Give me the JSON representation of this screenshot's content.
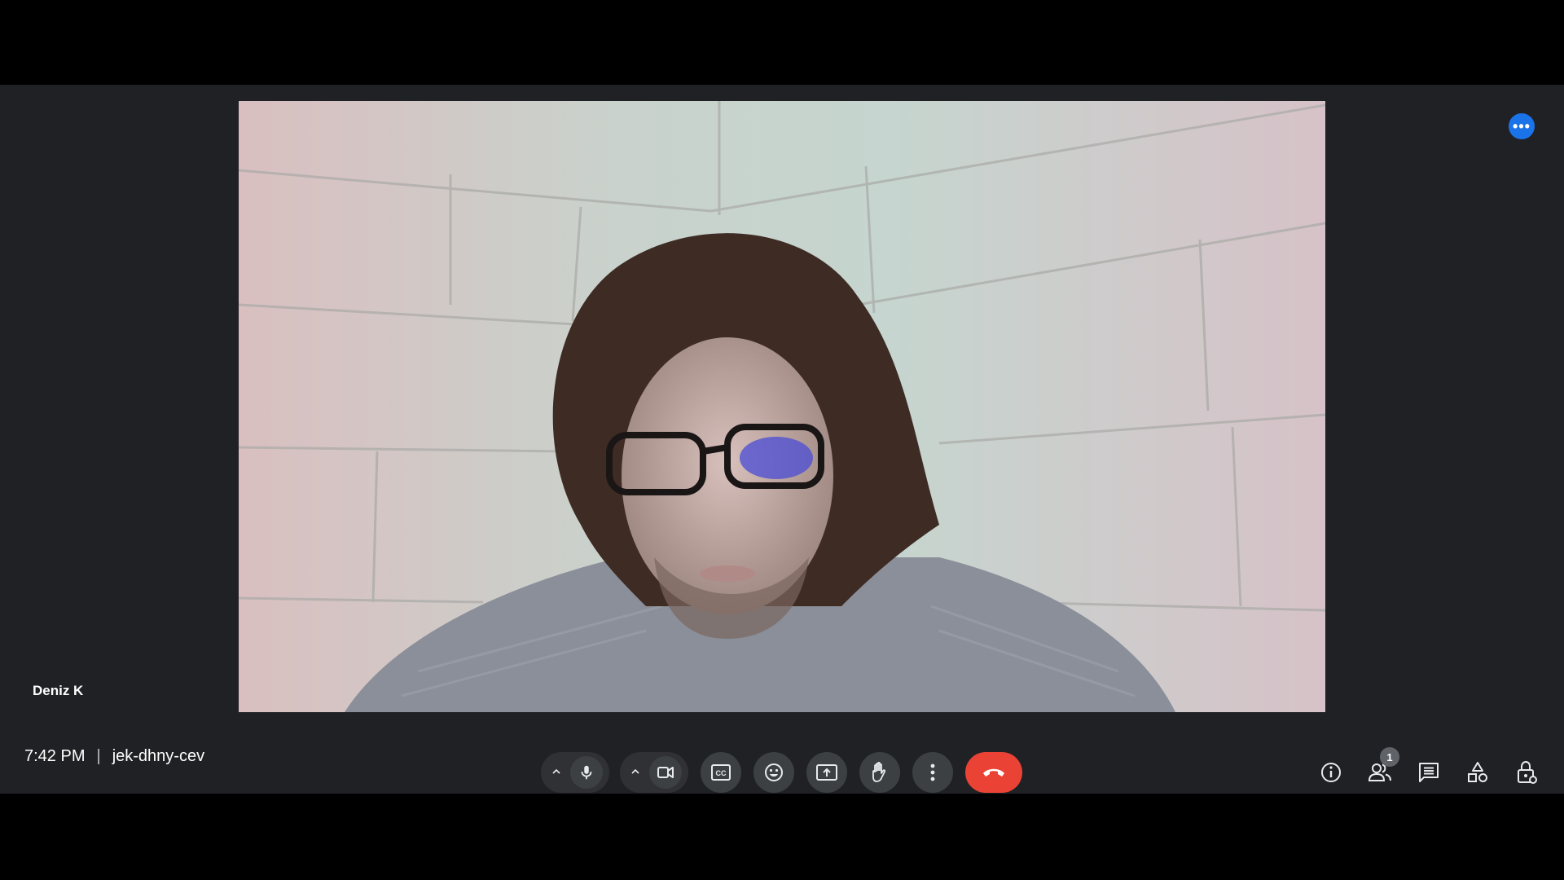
{
  "participant": {
    "name": "Deniz K"
  },
  "meeting": {
    "time": "7:42 PM",
    "separator": "|",
    "code": "jek-dhny-cev"
  },
  "tile_menu": {
    "label": "•••",
    "color": "#1a73e8"
  },
  "controls": [
    {
      "name": "audio-options-caret-icon"
    },
    {
      "name": "microphone-icon"
    },
    {
      "name": "video-options-caret-icon"
    },
    {
      "name": "camera-icon"
    },
    {
      "name": "captions-icon"
    },
    {
      "name": "emoji-icon"
    },
    {
      "name": "present-screen-icon"
    },
    {
      "name": "raise-hand-icon"
    },
    {
      "name": "more-options-icon"
    },
    {
      "name": "end-call-icon",
      "color": "#ea4335"
    }
  ],
  "side_controls": {
    "people_count": "1",
    "icons": [
      "info-icon",
      "people-icon",
      "chat-icon",
      "activities-icon",
      "host-controls-icon"
    ]
  },
  "colors": {
    "background": "#202124",
    "button": "#3c4043",
    "end_call": "#ea4335",
    "accent": "#1a73e8"
  }
}
